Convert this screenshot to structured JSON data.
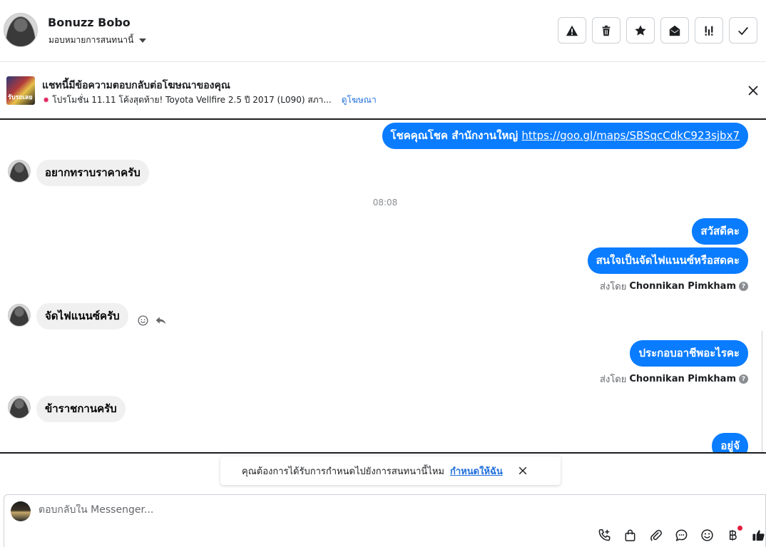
{
  "header": {
    "name": "Bonuzz Bobo",
    "assign_label": "มอบหมายการสนทนานี้",
    "actions": [
      {
        "icon": "warning-icon"
      },
      {
        "icon": "trash-icon"
      },
      {
        "icon": "star-icon"
      },
      {
        "icon": "envelope-open-icon"
      },
      {
        "icon": "follow-up-icon"
      },
      {
        "icon": "check-icon"
      }
    ]
  },
  "ad": {
    "title": "แชทนี้มีข้อความตอบกลับต่อโฆษณาของคุณ",
    "thumb_text": "รับรถเลย",
    "promo_text": "โปรโมชั่น 11.11 โค้งสุดท้าย! Toyota Vellfire 2.5 ปี 2017 (L090) สภา...",
    "view_ad_label": "ดูโฆษณา"
  },
  "messages": {
    "m1_text": "โชคคุณโชค สำนักงานใหญ่ ",
    "m1_link": "https://goo.gl/maps/SBSqcCdkC923sjbx7",
    "m2": "อยากทราบราคาครับ",
    "time": "08:08",
    "m3": "สวัสดีคะ",
    "m4": "สนใจเป็นจัดไฟแนนซ์หรือสดคะ",
    "sent_by_prefix": "ส่งโดย",
    "agent_name": "Chonnikan Pimkham",
    "m5": "จัดไฟแนนซ์ครับ",
    "m6": "ประกอบอาชีพอะไรคะ",
    "m7": "ข้าราชกานครับ",
    "m8": "อยู่จั"
  },
  "prompt": {
    "text": "คุณต้องการได้รับการกำหนดไปยังการสนทนานี้ไหม",
    "link": "กำหนดให้ฉัน"
  },
  "composer": {
    "placeholder": "ตอบกลับใน Messenger...",
    "tools": [
      "phone-add-icon",
      "shopping-bag-icon",
      "paperclip-icon",
      "saved-reply-icon",
      "emoji-icon",
      "baht-icon",
      "thumbs-up-icon"
    ]
  },
  "colors": {
    "outgoing_bubble": "#0a7cff",
    "incoming_bubble": "#f0f0f0",
    "link": "#216fdb"
  }
}
